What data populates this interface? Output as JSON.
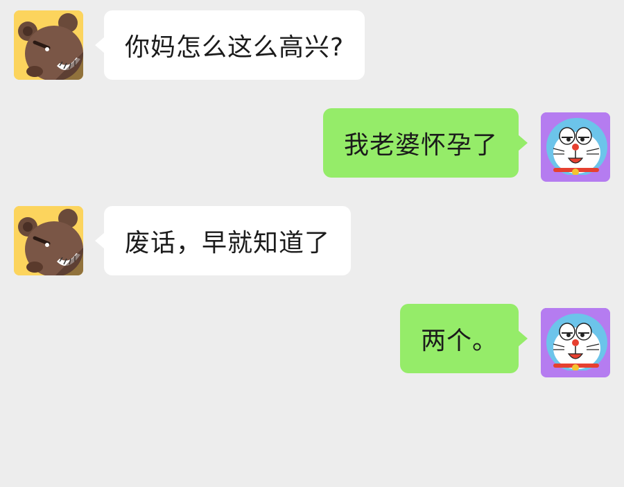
{
  "colors": {
    "background": "#ededed",
    "incoming_bubble": "#ffffff",
    "outgoing_bubble": "#95ec69",
    "bear_avatar_bg": "#fcd45d",
    "cat_avatar_bg": "#b57cf0"
  },
  "avatars": {
    "bear": {
      "icon": "bear-avatar-icon"
    },
    "cat": {
      "icon": "blue-robot-cat-avatar-icon"
    }
  },
  "messages": [
    {
      "side": "incoming",
      "avatar": "bear",
      "text": "你妈怎么这么高兴?"
    },
    {
      "side": "outgoing",
      "avatar": "cat",
      "text": "我老婆怀孕了"
    },
    {
      "side": "incoming",
      "avatar": "bear",
      "text": "废话，早就知道了"
    },
    {
      "side": "outgoing",
      "avatar": "cat",
      "text": "两个。"
    }
  ]
}
